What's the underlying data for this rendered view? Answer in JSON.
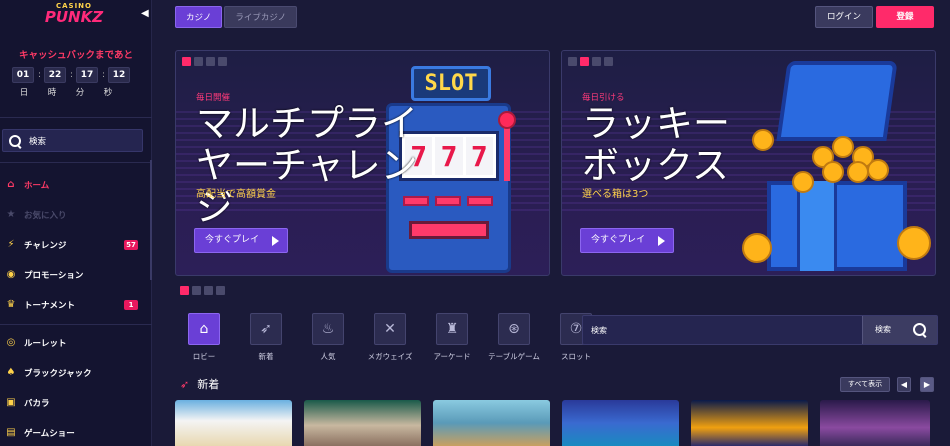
{
  "brand": {
    "line1": "CASINO",
    "line2": "PUNKZ"
  },
  "cashback": {
    "title": "キャッシュバックまであと",
    "timer": [
      "01",
      "22",
      "17",
      "12"
    ],
    "units": [
      "日",
      "時",
      "分",
      "秒"
    ]
  },
  "sidebar": {
    "search_label": "検索",
    "items": [
      {
        "label": "ホーム",
        "icon": "home-icon"
      },
      {
        "label": "お気に入り",
        "icon": "star-icon"
      },
      {
        "label": "チャレンジ",
        "icon": "lightning-icon",
        "badge": "57"
      },
      {
        "label": "プロモーション",
        "icon": "coin-icon"
      },
      {
        "label": "トーナメント",
        "icon": "trophy-icon",
        "badge": "1"
      },
      {
        "label": "ルーレット",
        "icon": "roulette-icon"
      },
      {
        "label": "ブラックジャック",
        "icon": "cards-icon"
      },
      {
        "label": "バカラ",
        "icon": "baccarat-icon"
      },
      {
        "label": "ゲームショー",
        "icon": "gameshow-icon"
      }
    ]
  },
  "header": {
    "tabs": [
      {
        "label": "カジノ"
      },
      {
        "label": "ライブカジノ"
      }
    ],
    "login_label": "ログイン",
    "register_label": "登録"
  },
  "banners": [
    {
      "subtitle": "毎日開催",
      "title": "マルチプライヤーチャレンジ",
      "description": "高配当で高額賞金",
      "button_label": "今すぐプレイ",
      "sign": "SLOT",
      "reels": [
        "7",
        "7",
        "7"
      ]
    },
    {
      "subtitle": "毎日引ける",
      "title": "ラッキーボックス",
      "description": "選べる箱は3つ",
      "button_label": "今すぐプレイ"
    }
  ],
  "categories": [
    {
      "label": "ロビー",
      "icon": "home-icon"
    },
    {
      "label": "新着",
      "icon": "rocket-icon"
    },
    {
      "label": "人気",
      "icon": "fire-icon"
    },
    {
      "label": "メガウェイズ",
      "icon": "expand-icon"
    },
    {
      "label": "アーケード",
      "icon": "invader-icon"
    },
    {
      "label": "テーブルゲーム",
      "icon": "chip-icon"
    },
    {
      "label": "スロット",
      "icon": "slot-icon"
    }
  ],
  "main_search": {
    "placeholder": "検索",
    "button_label": "検索"
  },
  "section": {
    "title": "新着",
    "show_all": "すべて表示"
  },
  "colors": {
    "accent": "#6a3fd6",
    "brand_pink": "#ff2a6a",
    "background": "#1a1a38"
  }
}
